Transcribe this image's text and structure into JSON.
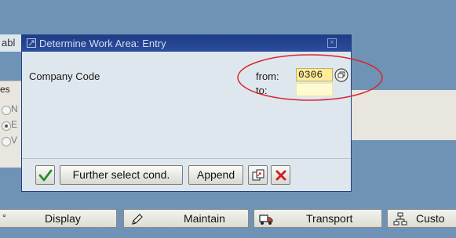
{
  "background": {
    "tab_fragment": "abl",
    "panel_fragment": "es",
    "radio_letters": [
      "N",
      "E",
      "V"
    ],
    "colors": {
      "desktop": "#6f93b6",
      "panel": "#e8e6df"
    }
  },
  "dialog": {
    "title": "Determine Work Area: Entry",
    "field_label": "Company Code",
    "from_label": "from:",
    "to_label": "to:",
    "from_value": "0306",
    "to_value": "",
    "title_color": "#1f3c85",
    "annotation_color": "#d9262a",
    "buttons": {
      "further_select": "Further select cond.",
      "append": "Append"
    },
    "icons": [
      "check-icon",
      "multiple-selection-icon",
      "close-icon",
      "copy-icon",
      "cancel-icon"
    ]
  },
  "toolbar": {
    "items": [
      {
        "label": "Display",
        "icon": "display-icon"
      },
      {
        "label": "Maintain",
        "icon": "pencil-icon"
      },
      {
        "label": "Transport",
        "icon": "truck-icon"
      },
      {
        "label": "Custo",
        "icon": "hierarchy-icon"
      }
    ]
  }
}
